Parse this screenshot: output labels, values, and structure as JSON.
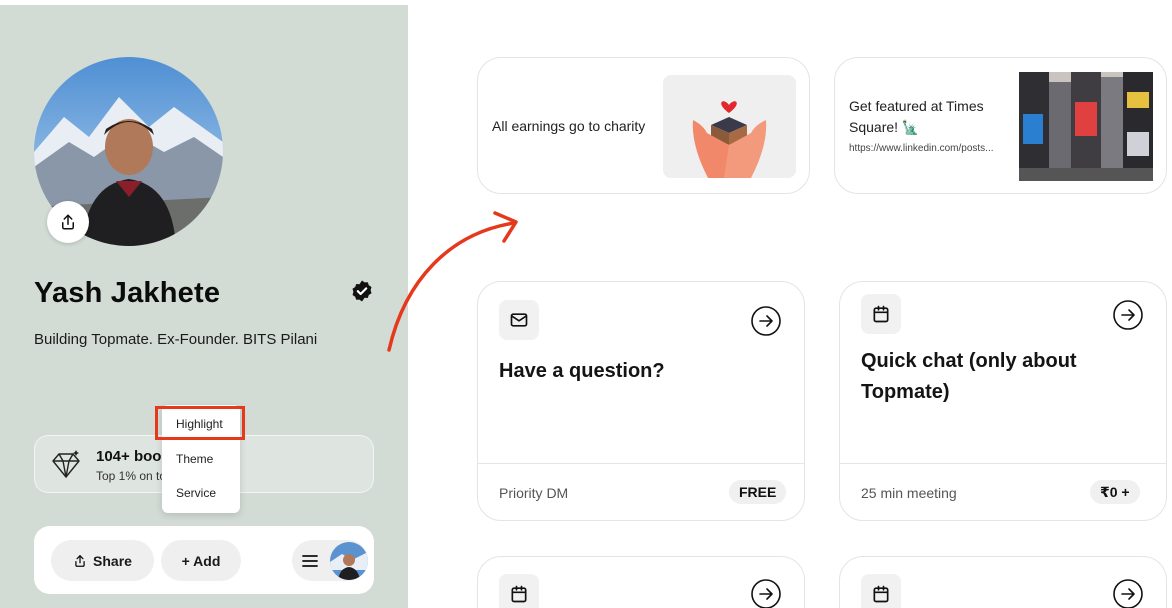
{
  "profile": {
    "name": "Yash Jakhete",
    "bio": "Building Topmate. Ex-Founder. BITS Pilani",
    "stats_title": "104+ bool",
    "stats_sub": "Top 1% on to"
  },
  "menu": {
    "items": [
      "Highlight",
      "Theme",
      "Service"
    ]
  },
  "bottom_bar": {
    "share_label": "Share",
    "add_label": "+ Add"
  },
  "highlights": [
    {
      "text": "All earnings go to charity"
    },
    {
      "text": "Get featured at Times Square! 🗽",
      "link": "https://www.linkedin.com/posts..."
    }
  ],
  "services": [
    {
      "title": "Have a question?",
      "meta": "Priority DM",
      "price": "FREE",
      "icon": "mail-icon"
    },
    {
      "title": "Quick chat (only about Topmate)",
      "meta": "25 min meeting",
      "price": "₹0 +",
      "icon": "calendar-icon"
    }
  ],
  "colors": {
    "panel_bg": "#d2dcd4",
    "accent_red": "#e5391d",
    "verified": "#111111"
  }
}
